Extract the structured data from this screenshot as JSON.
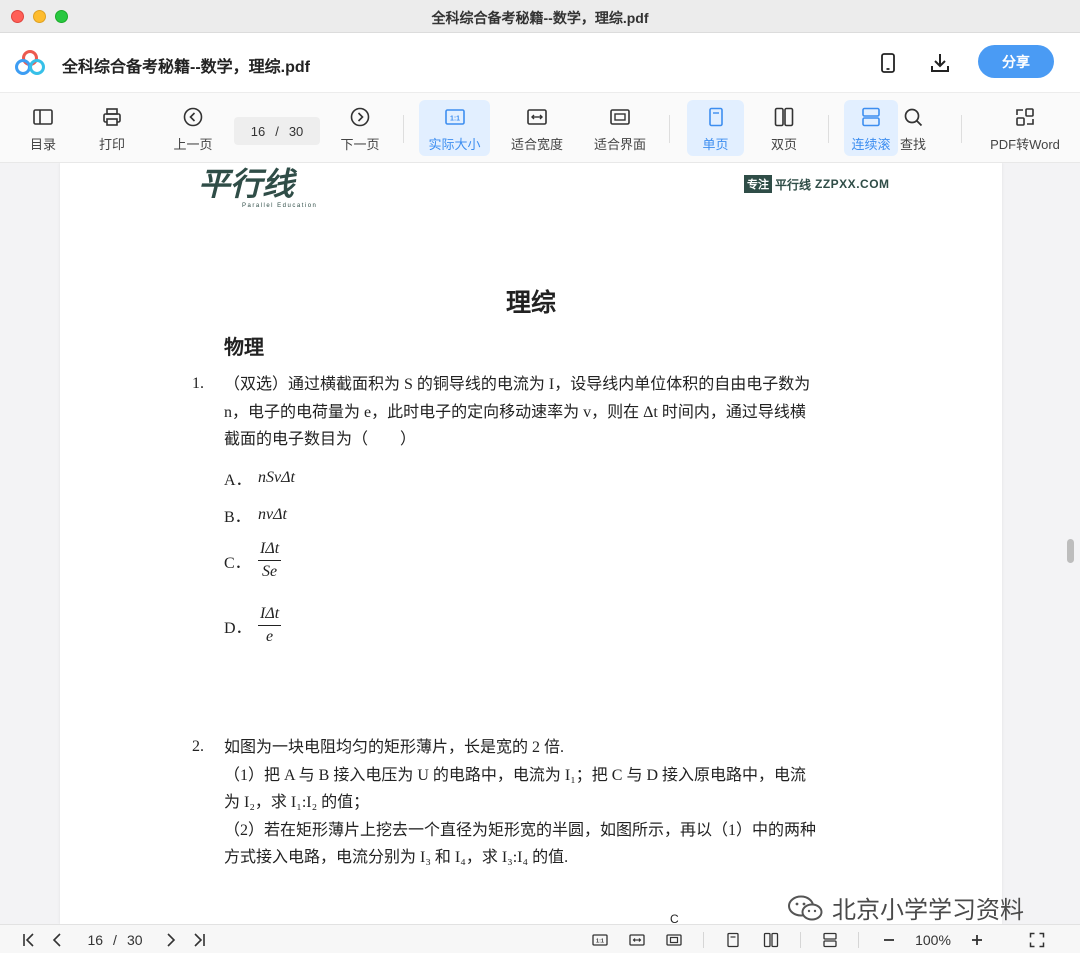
{
  "window": {
    "title": "全科综合备考秘籍--数学，理综.pdf"
  },
  "header": {
    "doc_title": "全科综合备考秘籍--数学，理综.pdf",
    "share_label": "分享",
    "logo_icon": "baidu-netdisk-logo",
    "accent": "#4a9bf4"
  },
  "toolbar": {
    "toc": "目录",
    "print": "打印",
    "prev": "上一页",
    "page_current": "16",
    "page_sep": "/",
    "page_total": "30",
    "next": "下一页",
    "actual_size": "实际大小",
    "fit_width": "适合宽度",
    "fit_page": "适合界面",
    "single": "单页",
    "double": "双页",
    "continuous": "连续滚",
    "find": "查找",
    "pdf_to_word": "PDF转Word"
  },
  "document": {
    "tag_box": "专注",
    "tag_name": "平行线",
    "tag_site": "ZZPXX.COM",
    "logo_text": "平行线",
    "logo_sub": "Parallel Education",
    "section": "理综",
    "subject": "物理",
    "q1": {
      "num": "1.",
      "line1": "（双选）通过横截面积为 S 的铜导线的电流为 I，设导线内单位体积的自由电子数为",
      "line2": "n，电子的电荷量为 e，此时电子的定向移动速率为 v，则在 Δt 时间内，通过导线横",
      "line3": "截面的电子数目为（　　）",
      "options": [
        {
          "label": "A．",
          "value": "nSvΔt"
        },
        {
          "label": "B．",
          "value": "nvΔt"
        },
        {
          "label": "C．",
          "num": "IΔt",
          "den": "Se"
        },
        {
          "label": "D．",
          "num": "IΔt",
          "den": "e"
        }
      ]
    },
    "q2": {
      "num": "2.",
      "line1": "如图为一块电阻均匀的矩形薄片，长是宽的 2 倍.",
      "line2": "（1）把 A 与 B 接入电压为 U 的电路中，电流为 I₁；把 C 与 D 接入原电路中，电流",
      "line3": "为 I₂，求 I₁:I₂ 的值；",
      "line4": "（2）若在矩形薄片上挖去一个直径为矩形宽的半圆，如图所示，再以（1）中的两种",
      "line5": "方式接入电路，电流分别为 I₃ 和 I₄，求 I₃:I₄ 的值."
    },
    "cursor_char": "C",
    "watermark": "北京小学学习资料"
  },
  "status": {
    "page_current": "16",
    "page_sep": "/",
    "page_total": "30",
    "zoom": "100%"
  }
}
